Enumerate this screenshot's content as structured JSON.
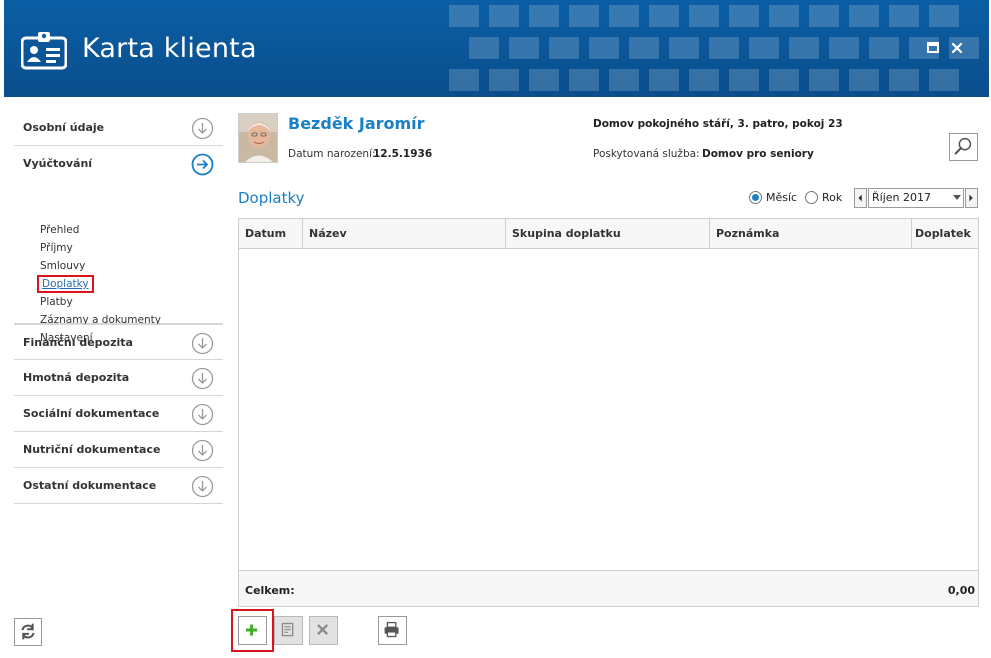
{
  "window": {
    "title": "Karta klienta"
  },
  "sidebar": {
    "sections": [
      {
        "label": "Osobní údaje"
      },
      {
        "label": "Vyúčtování",
        "items": [
          "Přehled",
          "Příjmy",
          "Smlouvy",
          "Doplatky",
          "Platby",
          "Záznamy a dokumenty",
          "Nastavení"
        ],
        "active": "Doplatky"
      },
      {
        "label": "Finanční depozita"
      },
      {
        "label": "Hmotná depozita"
      },
      {
        "label": "Sociální dokumentace"
      },
      {
        "label": "Nutriční dokumentace"
      },
      {
        "label": "Ostatní dokumentace"
      }
    ]
  },
  "client": {
    "name": "Bezděk Jaromír",
    "birth_label": "Datum narození:",
    "birth_date": "12.5.1936",
    "location": "Domov pokojného stáří, 3. patro, pokoj 23",
    "service_label": "Poskytovaná služba:",
    "service": "Domov pro seniory"
  },
  "main": {
    "title": "Doplatky",
    "period_options": [
      "Měsíc",
      "Rok"
    ],
    "period_selected": "Měsíc",
    "month": "Říjen 2017",
    "columns": [
      "Datum",
      "Název",
      "Skupina doplatku",
      "Poznámka",
      "Doplatek"
    ],
    "rows": [],
    "total_label": "Celkem:",
    "total_value": "0,00"
  },
  "colors": {
    "header": "#0a4e8c",
    "accent": "#1b7fc4",
    "highlight": "#d9141c",
    "add_icon": "#3fae29"
  }
}
